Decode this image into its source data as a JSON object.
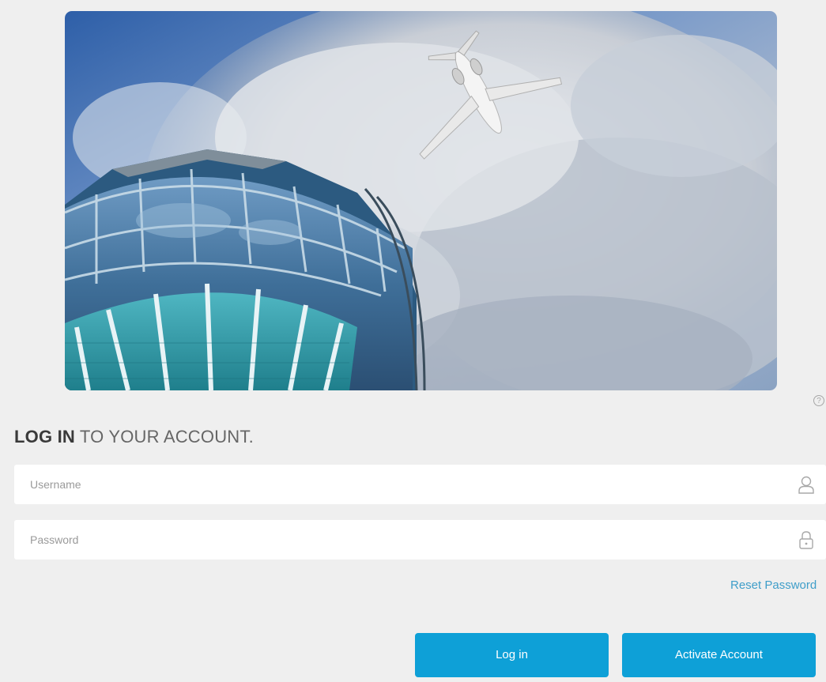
{
  "hero": {
    "image_description": "",
    "sky_color": "#3c6fb4",
    "cloud_color": "#d9dde3",
    "tower_glass_color": "#4a7fa8",
    "tower_teal_color": "#2f9fae"
  },
  "help": {
    "icon": "help-circle-icon",
    "glyph": "?"
  },
  "heading": {
    "strong": "LOG IN",
    "rest": " TO YOUR ACCOUNT."
  },
  "username": {
    "placeholder": "Username",
    "value": "",
    "icon": "user-icon"
  },
  "password": {
    "placeholder": "Password",
    "value": "",
    "icon": "lock-icon"
  },
  "reset_password": {
    "label": "Reset Password"
  },
  "buttons": {
    "login_label": "Log in",
    "activate_label": "Activate Account",
    "color": "#0ea0d7"
  }
}
